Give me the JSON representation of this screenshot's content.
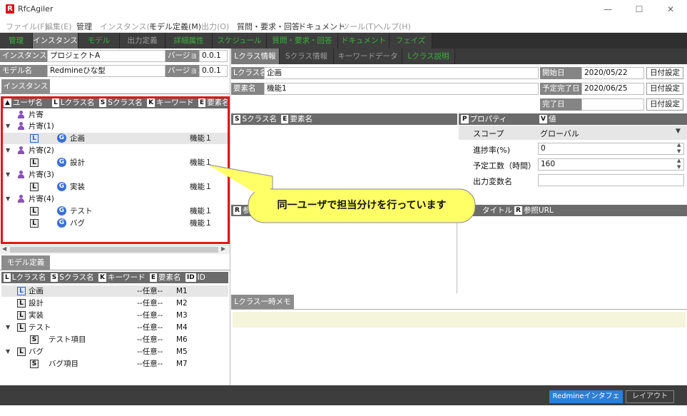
{
  "window": {
    "logo": "R",
    "title": "RfcAgiler",
    "minimize": "—",
    "maximize": "☐",
    "close": "✕"
  },
  "menu": [
    {
      "label": "ファイル(F)",
      "on": false
    },
    {
      "label": "編集(E)",
      "on": false
    },
    {
      "label": "管理",
      "on": true
    },
    {
      "label": "インスタンス(I)",
      "on": false
    },
    {
      "label": "モデル定義(M)",
      "on": true
    },
    {
      "label": "出力(O)",
      "on": false
    },
    {
      "label": "質問・要求・回答",
      "on": true
    },
    {
      "label": "ドキュメント",
      "on": true
    },
    {
      "label": "ツール(T)",
      "on": false
    },
    {
      "label": "ヘルプ(H)",
      "on": false
    }
  ],
  "top_tabs": [
    "管理",
    "インスタンス",
    "モデル",
    "出力定義",
    "詳細属性",
    "スケジュール",
    "質問・要求・回答",
    "ドキュメント",
    "フェイズ"
  ],
  "left": {
    "instance_label": "インスタンス名",
    "instance_value": "プロジェクトA",
    "version_label": "バージョン",
    "version_value": "0.0.1",
    "model_label": "モデル名",
    "model_value": "Redmineひな型",
    "model_version_label": "バージョン",
    "model_version_value": "0.0.1",
    "instance_tab": "インスタンス",
    "headers": {
      "user_box": "▲",
      "user": "ユーザ名",
      "l_box": "L",
      "l": "Lクラス名",
      "s_box": "S",
      "s": "Sクラス名",
      "k_box": "K",
      "k": "キーワード",
      "e_box": "E",
      "e": "要素名"
    },
    "tree": {
      "u0": "片寄",
      "u1": "片寄(1)",
      "u1c": "企画",
      "u1e": "機能１",
      "u2": "片寄(2)",
      "u2c": "設計",
      "u2e": "機能１",
      "u3": "片寄(3)",
      "u3c": "実装",
      "u3e": "機能１",
      "u4": "片寄(4)",
      "u4c1": "テスト",
      "u4e1": "機能１",
      "u4c2": "バグ",
      "u4e2": "機能１"
    },
    "model_tab": "モデル定義",
    "model_headers": {
      "l_box": "L",
      "l": "Lクラス名",
      "s_box": "S",
      "s": "Sクラス名",
      "k_box": "K",
      "k": "キーワード",
      "e_box": "E",
      "e": "要素名",
      "id_box": "ID",
      "id": "ID"
    },
    "model_rows": {
      "r1": "企画",
      "r1k": "--任意--",
      "r1id": "M1",
      "r2": "設計",
      "r2k": "--任意--",
      "r2id": "M2",
      "r3": "実装",
      "r3k": "--任意--",
      "r3id": "M3",
      "r4": "テスト",
      "r4k": "--任意--",
      "r4id": "M4",
      "r5": "テスト項目",
      "r5k": "--任意--",
      "r5id": "M6",
      "r6": "バグ",
      "r6k": "--任意--",
      "r6id": "M5",
      "r7": "バグ項目",
      "r7k": "--任意--",
      "r7id": "M7"
    }
  },
  "right": {
    "tabs": [
      "Lクラス情報",
      "Sクラス情報",
      "キーワードデータ",
      "Lクラス説明"
    ],
    "lclass_label": "Lクラス名",
    "lclass_value": "企画",
    "elem_label": "要素名",
    "elem_value": "機能1",
    "start_label": "開始日",
    "start_value": "2020/05/22",
    "start_btn": "日付設定",
    "due_label": "予定完了日",
    "due_value": "2020/06/25",
    "due_btn": "日付設定",
    "done_label": "完了日",
    "done_value": "",
    "done_btn": "日付設定",
    "sc_headers": {
      "s_box": "S",
      "s": "Sクラス名",
      "e_box": "E",
      "e": "要素名"
    },
    "prop_headers": {
      "p_box": "P",
      "p": "プロパティ",
      "v_box": "V",
      "v": "値"
    },
    "props": {
      "scope": "スコープ",
      "scope_val": "グローバル",
      "progress": "進捗率(%)",
      "progress_val": "0",
      "plan": "予定工数（時間）",
      "plan_val": "160",
      "output": "出力変数名",
      "output_val": ""
    },
    "ref_headers": {
      "r_box": "R",
      "r": "参",
      "title": "タイトル",
      "r2_box": "R",
      "url": "参照URL"
    },
    "memo_tab": "Lクラス一時メモ"
  },
  "callout": "同一ユーザで担当分けを行っています",
  "status": {
    "redmine": "Redmineインタフェース",
    "layout": "レイアウト"
  },
  "colors": {
    "accent_red": "#e01818",
    "callout_fill": "#ffff66",
    "memo_fill": "#f5f5dc"
  }
}
